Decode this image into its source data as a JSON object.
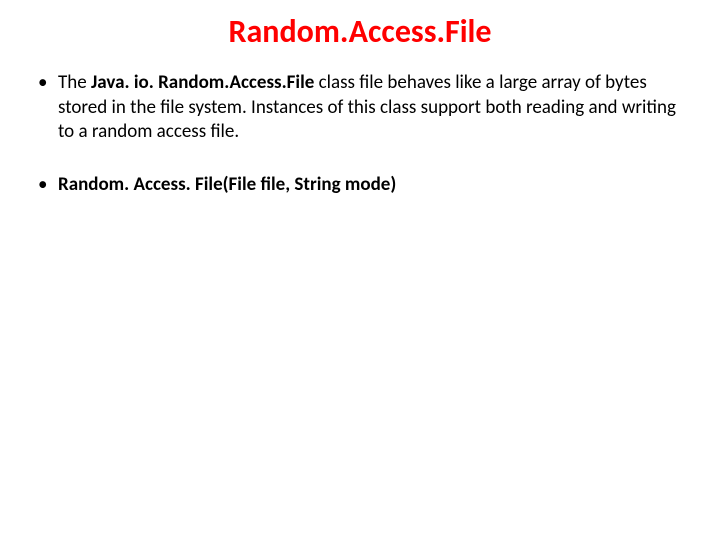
{
  "title": "Random.Access.File",
  "bullets": [
    {
      "prefix": "The ",
      "bold": "Java. io. Random.Access.File",
      "rest": " class file behaves like a large array of bytes stored in the file system. Instances of this class support both reading and writing to a random access file."
    },
    {
      "prefix": "",
      "bold": "Random. Access. File(File file, String mode)",
      "rest": ""
    }
  ]
}
